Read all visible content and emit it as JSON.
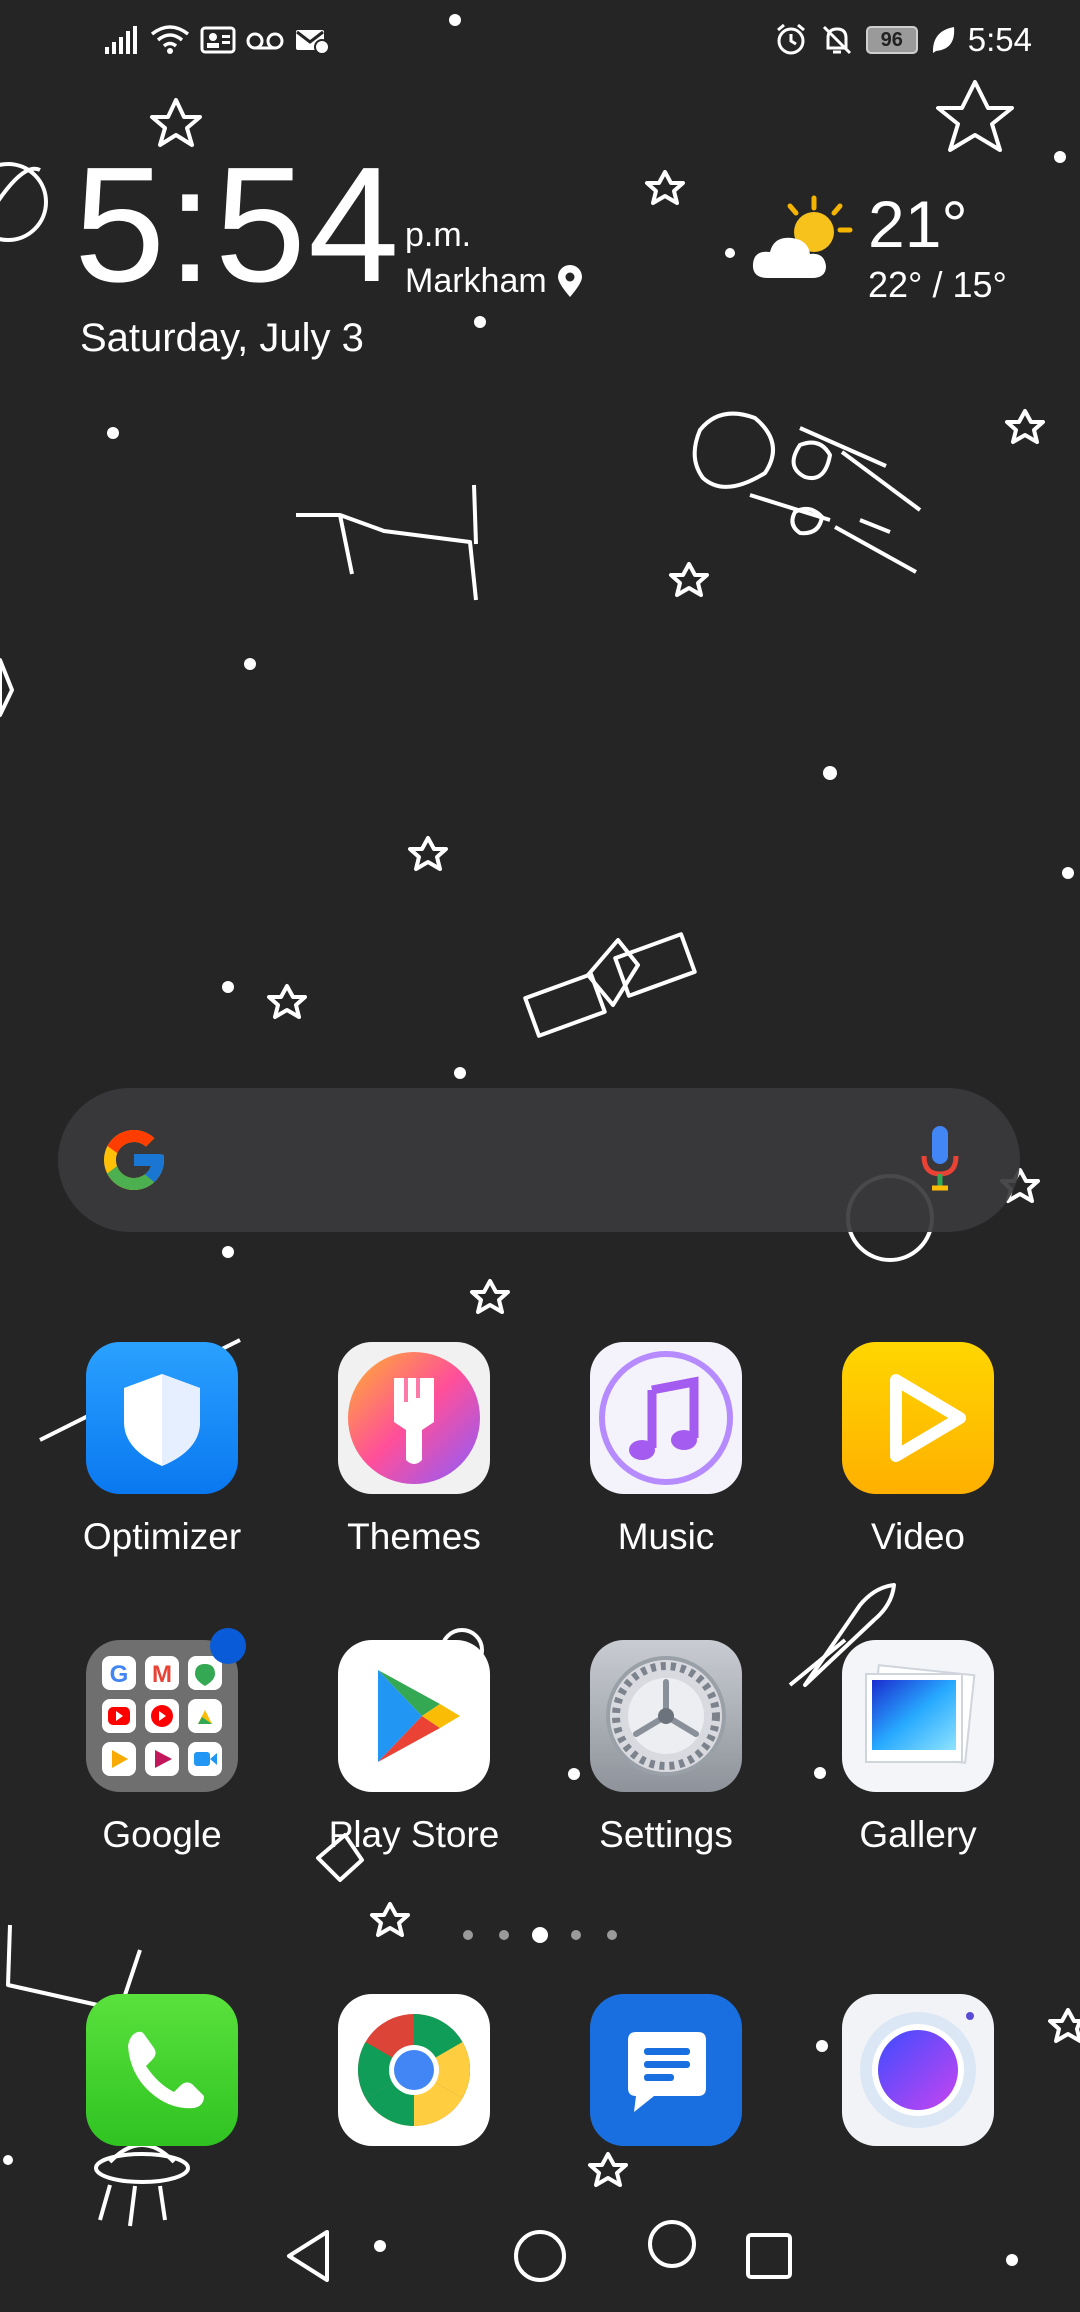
{
  "status_bar": {
    "time": "5:54",
    "battery": "96",
    "left_icons": [
      "signal-icon",
      "wifi-icon",
      "contact-card-icon",
      "voicemail-icon",
      "mail-icon"
    ],
    "right_icons": [
      "alarm-icon",
      "muted-bell-icon",
      "battery-icon",
      "leaf-icon"
    ]
  },
  "clock_widget": {
    "time": "5:54",
    "ampm": "p.m.",
    "city": "Markham",
    "date": "Saturday, July 3"
  },
  "weather": {
    "temp": "21°",
    "range": "22° / 15°",
    "icon": "partly-cloudy-icon"
  },
  "search_bar": {
    "logo": "google-g-icon",
    "mic": "mic-icon"
  },
  "apps": [
    {
      "label": "Optimizer",
      "icon": "optimizer-shield-icon"
    },
    {
      "label": "Themes",
      "icon": "themes-brush-icon"
    },
    {
      "label": "Music",
      "icon": "music-note-icon"
    },
    {
      "label": "Video",
      "icon": "video-play-icon"
    },
    {
      "label": "Google",
      "icon": "google-folder-icon"
    },
    {
      "label": "Play Store",
      "icon": "play-store-icon"
    },
    {
      "label": "Settings",
      "icon": "settings-gear-icon"
    },
    {
      "label": "Gallery",
      "icon": "gallery-icon"
    }
  ],
  "dock": [
    {
      "name": "phone",
      "icon": "phone-icon"
    },
    {
      "name": "chrome",
      "icon": "chrome-icon"
    },
    {
      "name": "messages",
      "icon": "messages-icon"
    },
    {
      "name": "camera",
      "icon": "camera-icon"
    }
  ],
  "page_indicator": {
    "pages": 5,
    "current": 3
  },
  "colors": {
    "background": "#252525",
    "optimizer": "#1a8cff",
    "video": "#ffc400",
    "phone": "#3ccf2e",
    "messages": "#1a6fe0",
    "badge": "#0a5bd7"
  }
}
